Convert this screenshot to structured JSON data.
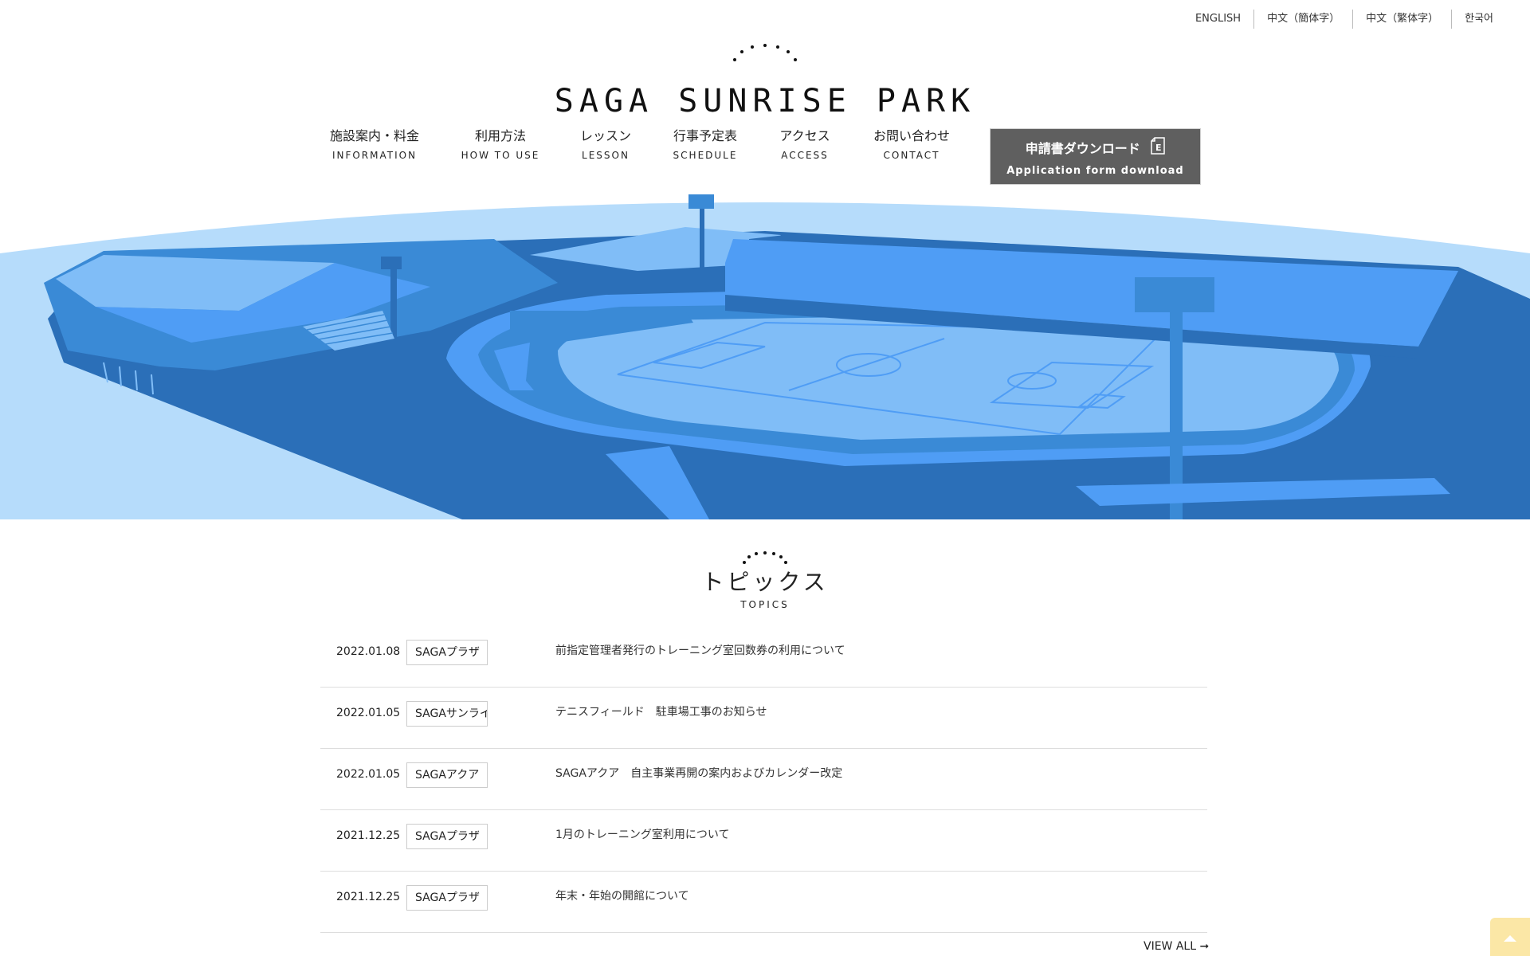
{
  "languages": [
    "ENGLISH",
    "中文（簡体字）",
    "中文（繁体字）",
    "한국어"
  ],
  "logo": {
    "text": "SAGA SUNRISE PARK"
  },
  "nav": [
    {
      "jp": "施設案内・料金",
      "en": "INFORMATION"
    },
    {
      "jp": "利用方法",
      "en": "HOW TO USE"
    },
    {
      "jp": "レッスン",
      "en": "LESSON"
    },
    {
      "jp": "行事予定表",
      "en": "SCHEDULE"
    },
    {
      "jp": "アクセス",
      "en": "ACCESS"
    },
    {
      "jp": "お問い合わせ",
      "en": "CONTACT"
    }
  ],
  "download": {
    "jp": "申請書ダウンロード",
    "en": "Application form download",
    "icon": "document-icon"
  },
  "hero": {
    "illustration": "stadium-illustration",
    "colors": {
      "sky": "#b6dcfb",
      "dark": "#2b6fb8",
      "mid": "#3a8ad6",
      "light": "#80bdf7",
      "bright": "#4f9df5"
    }
  },
  "topics": {
    "title": "トピックス",
    "subtitle": "TOPICS",
    "items": [
      {
        "date": "2022.01.08",
        "category": "SAGAプラザ",
        "title": "前指定管理者発行のトレーニング室回数券の利用について"
      },
      {
        "date": "2022.01.05",
        "category": "SAGAサンライ",
        "title": "テニスフィールド　駐車場工事のお知らせ"
      },
      {
        "date": "2022.01.05",
        "category": "SAGAアクア",
        "title": "SAGAアクア　自主事業再開の案内およびカレンダー改定"
      },
      {
        "date": "2021.12.25",
        "category": "SAGAプラザ",
        "title": "1月のトレーニング室利用について"
      },
      {
        "date": "2021.12.25",
        "category": "SAGAプラザ",
        "title": "年末・年始の開館について"
      }
    ],
    "view_all": "VIEW ALL ➞"
  },
  "back_to_top": {
    "icon": "arrow-up-icon",
    "color": "#fbe7a6"
  }
}
